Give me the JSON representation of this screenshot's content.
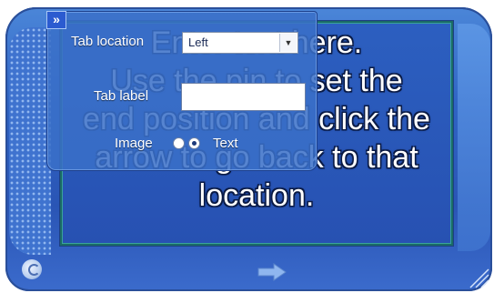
{
  "message": {
    "text": "Enter text here.\nUse the pin to set the\nend position and click the\narrow to go back to that\nlocation."
  },
  "popup": {
    "collapse_glyph": "»",
    "tab_location_label": "Tab location",
    "tab_location_value": "Left",
    "tab_label_label": "Tab label",
    "tab_label_value": "",
    "image_label": "Image",
    "text_label": "Text",
    "selected_option": "Text"
  },
  "icons": {
    "pin": "pin-icon",
    "arrow": "arrow-right-icon",
    "resize": "resize-grip-icon"
  },
  "colors": {
    "panel_blue": "#2f64c4",
    "frame_teal": "#1a6a66",
    "popup_blue": "#3a70c8"
  }
}
